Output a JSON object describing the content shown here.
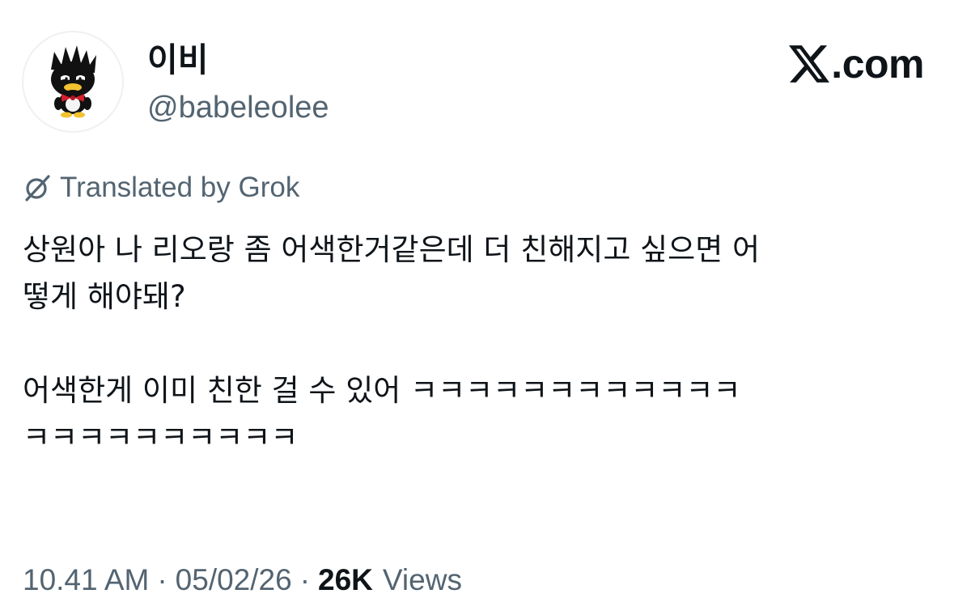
{
  "author": {
    "display_name": "이비",
    "handle": "@babeleolee",
    "avatar_icon": "badtz-maru-avatar-icon"
  },
  "brand": {
    "icon": "x-logo-icon",
    "text": ".com"
  },
  "translation": {
    "icon": "grok-icon",
    "label": "Translated by Grok"
  },
  "tweet": {
    "lines": [
      "상원아 나 리오랑 좀 어색한거같은데 더 친해지고 싶으면 어",
      "떻게 해야돼?",
      "",
      "어색한게 이미 친한 걸 수 있어 ㅋㅋㅋㅋㅋㅋㅋㅋㅋㅋㅋㅋ",
      "ㅋㅋㅋㅋㅋㅋㅋㅋㅋㅋ"
    ]
  },
  "meta": {
    "time": "10.41 AM",
    "separator": "·",
    "date": "05/02/26",
    "views_count": "26K",
    "views_label": "Views"
  },
  "colors": {
    "text_primary": "#0f1419",
    "text_secondary": "#536471"
  }
}
